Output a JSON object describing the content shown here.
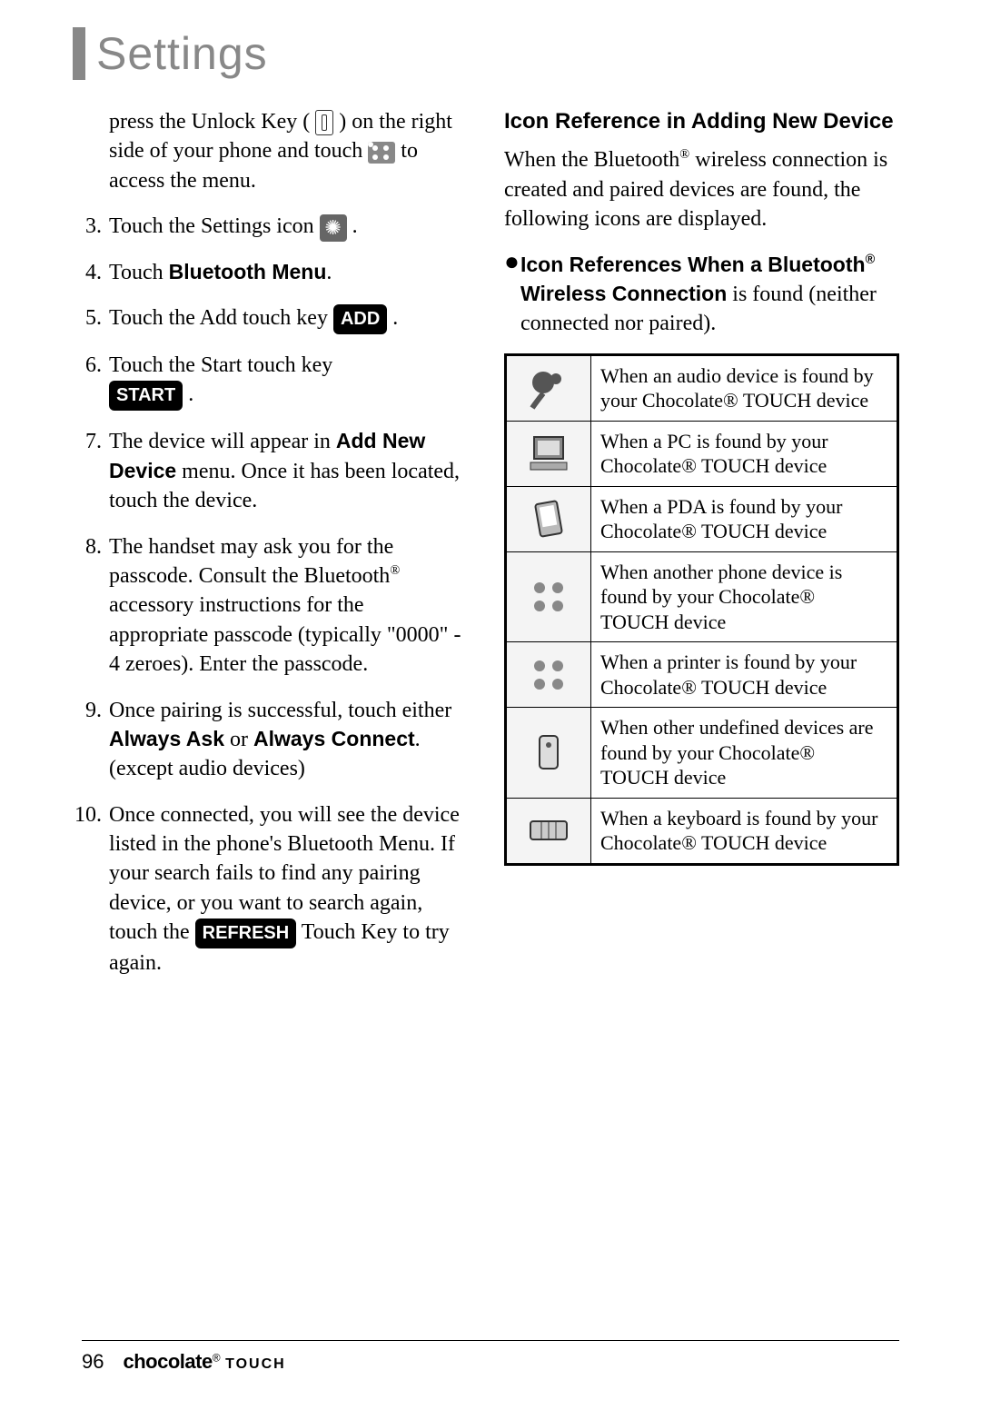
{
  "title": "Settings",
  "left": {
    "intro_line1": "press the Unlock Key (",
    "intro_line2": ") on the right side of your phone and touch",
    "intro_line3": " to access the menu.",
    "steps": {
      "s3_pre": "Touch the Settings icon ",
      "s3_post": ".",
      "s4": "Touch ",
      "s4_bold": "Bluetooth Menu",
      "s4_post": ".",
      "s5_pre": "Touch the Add touch key ",
      "s5_btn": "ADD",
      "s5_post": ".",
      "s6_pre": "Touch the Start touch key",
      "s6_btn": "START",
      "s6_post": ".",
      "s7_pre": "The device will appear in ",
      "s7_b1": "Add New Device",
      "s7_mid": " menu. Once it has been located, touch the device.",
      "s8": "The handset may ask you for the passcode. Consult the Bluetooth",
      "s8_reg": "®",
      "s8_post": " accessory instructions for the appropriate passcode (typically \"0000\" - 4 zeroes). Enter the passcode.",
      "s9_pre": "Once pairing is successful, touch either ",
      "s9_b1": "Always Ask",
      "s9_mid": " or ",
      "s9_b2": "Always Connect",
      "s9_post": ". (except audio devices)",
      "s10_pre": "Once connected, you will see the device listed in the phone's Bluetooth Menu. If your search fails to find any pairing device, or you want to search again, touch the ",
      "s10_btn": "REFRESH",
      "s10_post": " Touch Key to try again."
    }
  },
  "right": {
    "heading": "Icon Reference in Adding New Device",
    "intro_pre": "When the Bluetooth",
    "intro_reg": "®",
    "intro_post": " wireless connection is created and paired devices are found, the following icons are displayed.",
    "bullet_b1": "Icon References When a Bluetooth",
    "bullet_reg": "®",
    "bullet_b2": " Wireless Connection",
    "bullet_tail": " is found (neither connected nor paired).",
    "table": [
      {
        "icon": "audio",
        "text": "When an audio device is found by your Chocolate® TOUCH device"
      },
      {
        "icon": "pc",
        "text": "When a PC is found by your Chocolate® TOUCH device"
      },
      {
        "icon": "pda",
        "text": "When a PDA is found by your Chocolate® TOUCH device"
      },
      {
        "icon": "phone",
        "text": "When another phone device is found by your Chocolate® TOUCH device"
      },
      {
        "icon": "printer",
        "text": "When a printer is found by your Chocolate® TOUCH device"
      },
      {
        "icon": "other",
        "text": "When other undefined devices are found by your Chocolate® TOUCH device"
      },
      {
        "icon": "keyboard",
        "text": "When a keyboard is found by your Chocolate® TOUCH device"
      }
    ]
  },
  "footer": {
    "page": "96",
    "brand1": "chocolate",
    "brand_reg": "®",
    "brand2": "TOUCH"
  }
}
